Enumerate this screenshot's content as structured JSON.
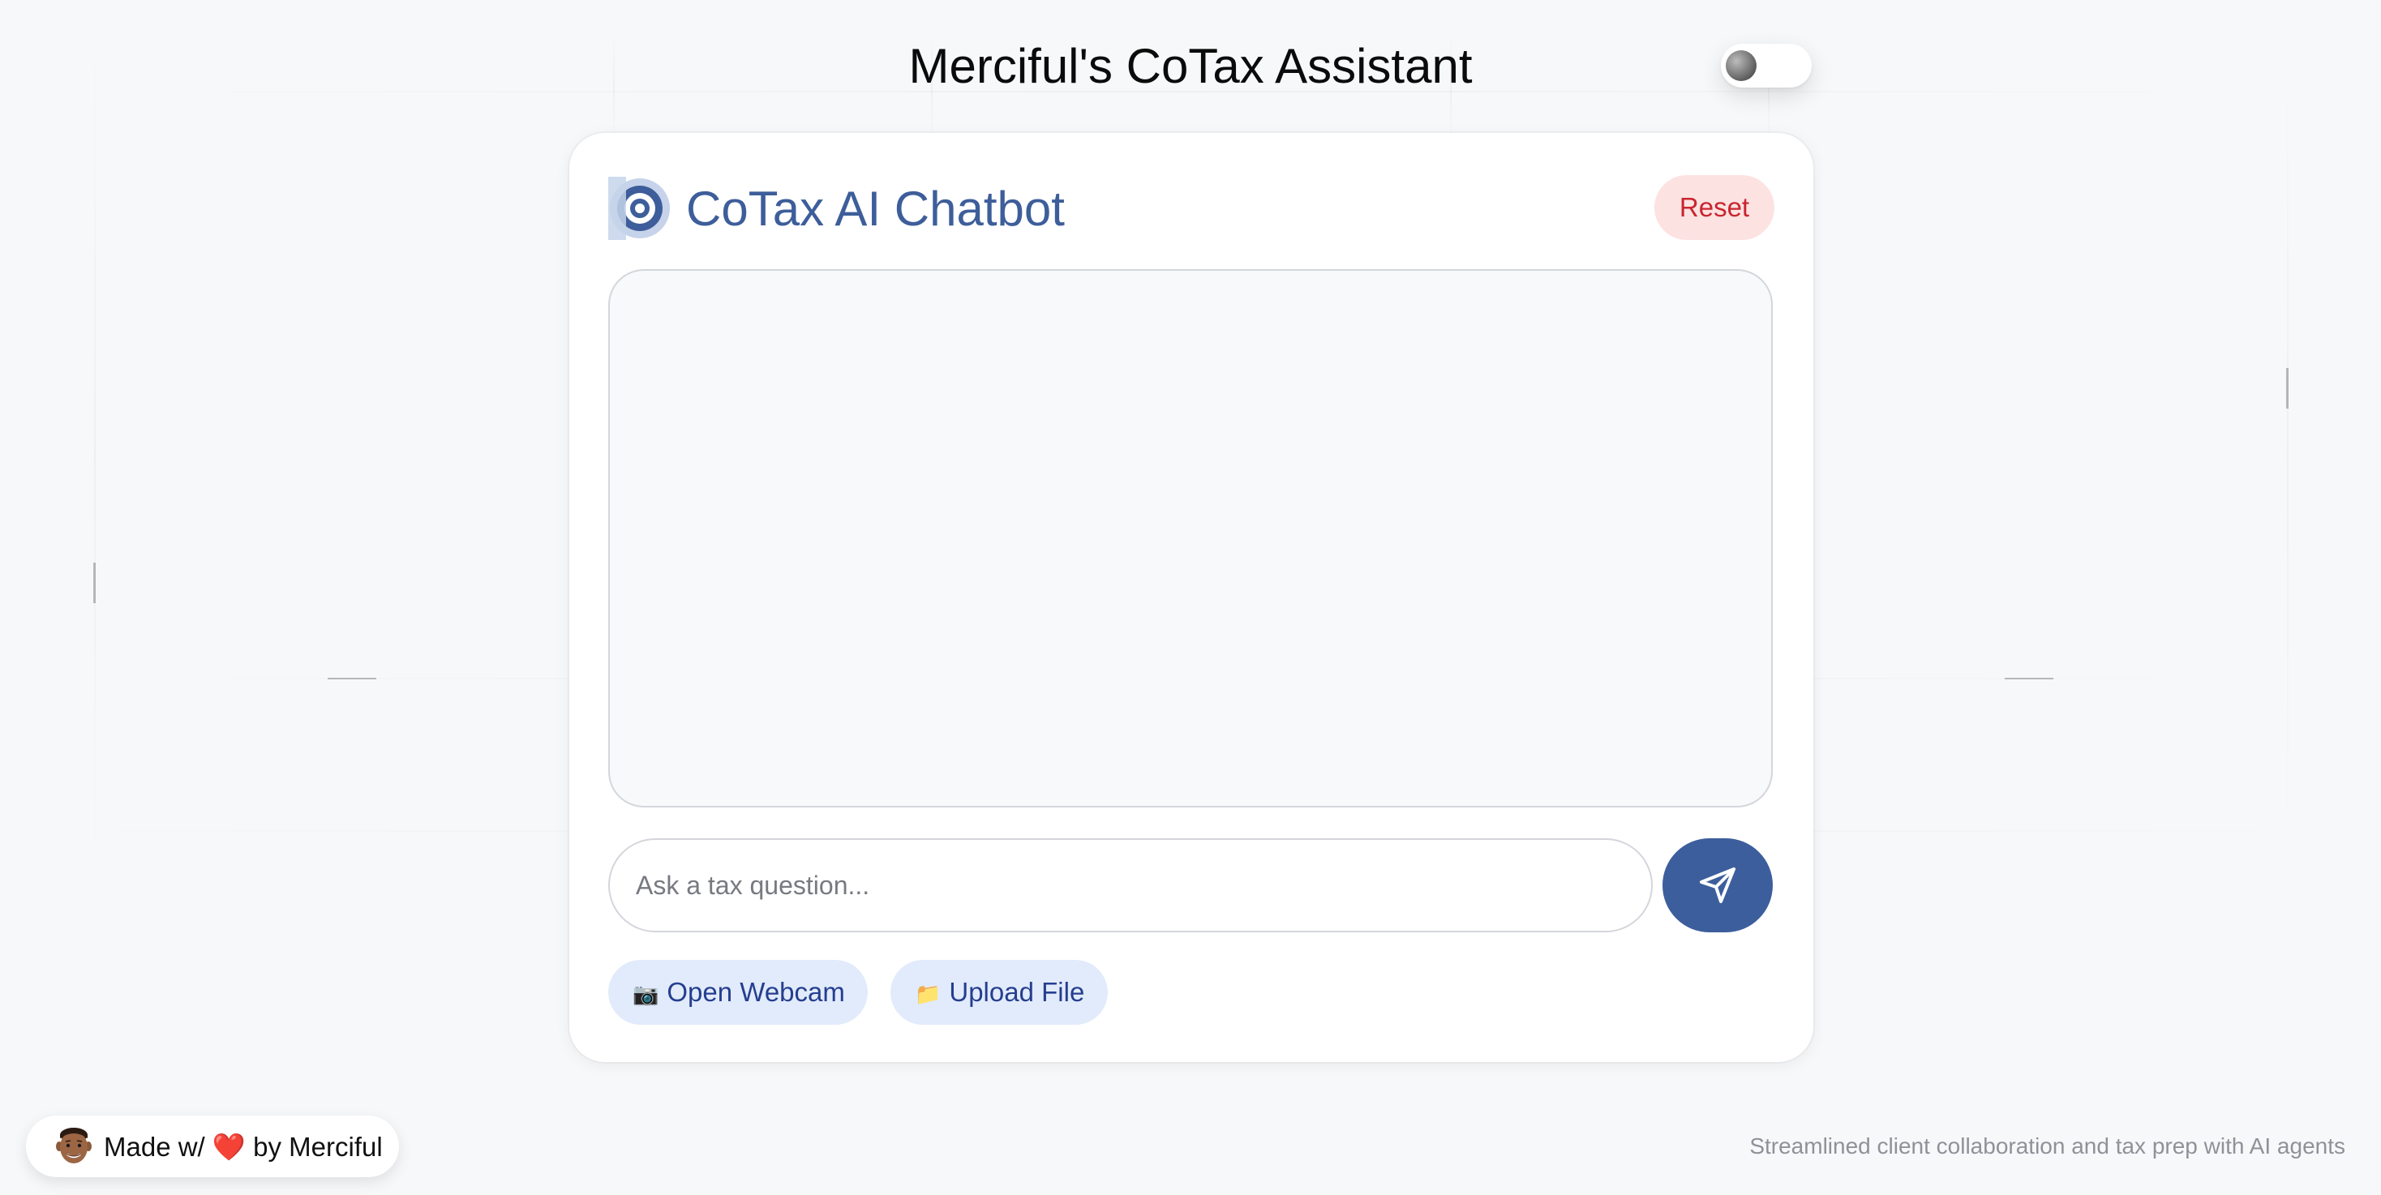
{
  "header": {
    "title": "Merciful's CoTax Assistant",
    "theme_toggle_state": "off"
  },
  "chat": {
    "logo_icon": "cotax-logo-icon",
    "title": "CoTax AI Chatbot",
    "reset_label": "Reset",
    "input_placeholder": "Ask a tax question...",
    "input_value": "",
    "send_icon": "paper-plane-icon",
    "actions": [
      {
        "emoji": "📷",
        "label": "Open Webcam"
      },
      {
        "emoji": "📁",
        "label": "Upload File"
      }
    ]
  },
  "footer": {
    "made_by_prefix": "Made w/",
    "heart": "❤️",
    "made_by_suffix": "by Merciful",
    "tagline": "Streamlined client collaboration and tax prep with AI agents"
  },
  "colors": {
    "accent": "#3c5e9d",
    "reset_bg": "#fde2e2",
    "reset_text": "#c9252d",
    "action_bg": "#e2ebfb",
    "action_text": "#253e8f"
  }
}
